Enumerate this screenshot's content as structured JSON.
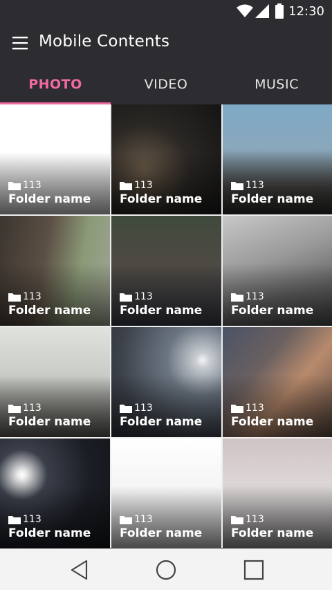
{
  "status": {
    "time": "12:30"
  },
  "appbar": {
    "title": "Mobile Contents"
  },
  "tabs": [
    {
      "label": "PHOTO",
      "active": true
    },
    {
      "label": "VIDEO",
      "active": false
    },
    {
      "label": "MUSIC",
      "active": false
    }
  ],
  "folders": [
    {
      "count": "113",
      "name": "Folder name"
    },
    {
      "count": "113",
      "name": "Folder name"
    },
    {
      "count": "113",
      "name": "Folder name"
    },
    {
      "count": "113",
      "name": "Folder name"
    },
    {
      "count": "113",
      "name": "Folder name"
    },
    {
      "count": "113",
      "name": "Folder name"
    },
    {
      "count": "113",
      "name": "Folder name"
    },
    {
      "count": "113",
      "name": "Folder name"
    },
    {
      "count": "113",
      "name": "Folder name"
    },
    {
      "count": "113",
      "name": "Folder name"
    },
    {
      "count": "113",
      "name": "Folder name"
    },
    {
      "count": "113",
      "name": "Folder name"
    }
  ],
  "icons": {
    "menu": "hamburger-menu-icon",
    "folder": "folder-icon",
    "back": "back-triangle-icon",
    "home": "home-circle-icon",
    "recents": "recents-square-icon"
  },
  "colors": {
    "accent": "#ef6aa0",
    "bar": "#2d2c31"
  }
}
